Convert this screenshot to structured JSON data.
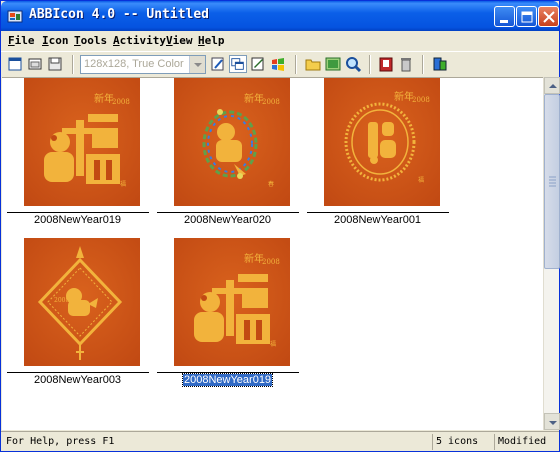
{
  "window": {
    "title": "ABBIcon 4.0 -- Untitled",
    "controls": {
      "minimize": "minimize",
      "maximize": "maximize",
      "close": "close"
    }
  },
  "menu": {
    "items": [
      {
        "key": "F",
        "rest": "ile"
      },
      {
        "key": "I",
        "rest": "con"
      },
      {
        "key": "T",
        "rest": "ools"
      },
      {
        "key": "A",
        "rest": "ctivity"
      },
      {
        "key": "V",
        "rest": "iew"
      },
      {
        "key": "H",
        "rest": "elp"
      }
    ]
  },
  "toolbar": {
    "format_value": "128x128, True Color",
    "icons": [
      "new-icon",
      "open-icon",
      "save-icon",
      "format-combo",
      "edit-icon",
      "layers-icon",
      "properties-icon",
      "windows-icon",
      "folder-icon",
      "image-icon",
      "zoom-icon",
      "export-icon",
      "delete-icon",
      "extract-icon"
    ]
  },
  "icons": [
    {
      "name": "2008NewYear019",
      "selected": false
    },
    {
      "name": "2008NewYear020",
      "selected": false
    },
    {
      "name": "2008NewYear001",
      "selected": false
    },
    {
      "name": "2008NewYear003",
      "selected": false
    },
    {
      "name": "2008NewYear019",
      "selected": true
    }
  ],
  "thumb_text": {
    "year": "2008",
    "script": "新年"
  },
  "status": {
    "help": "For Help, press F1",
    "count": "5 icons",
    "state": "Modified"
  },
  "colors": {
    "title_bar": "#0553e0",
    "thumb_bg": "#c24a13",
    "thumb_gold": "#f2b33c",
    "selection": "#316ac5"
  }
}
